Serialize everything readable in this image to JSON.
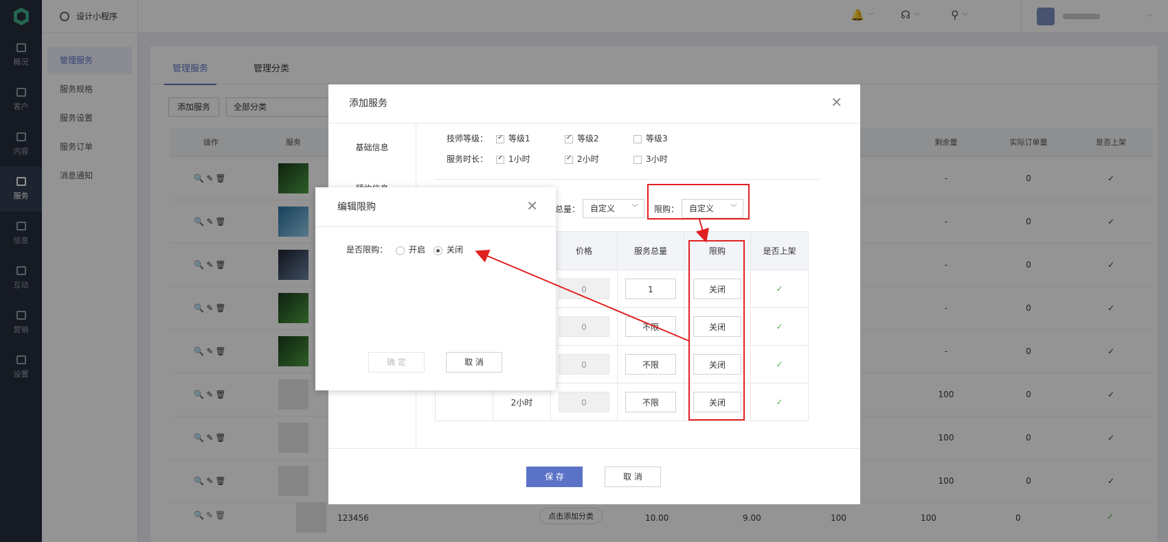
{
  "app": {
    "name": "设计小程序"
  },
  "nav": [
    {
      "label": "概况"
    },
    {
      "label": "客户"
    },
    {
      "label": "内容"
    },
    {
      "label": "服务"
    },
    {
      "label": "信息"
    },
    {
      "label": "互动"
    },
    {
      "label": "营销"
    },
    {
      "label": "设置"
    }
  ],
  "submenu": [
    {
      "label": "管理服务"
    },
    {
      "label": "服务规格"
    },
    {
      "label": "服务设置"
    },
    {
      "label": "服务订单"
    },
    {
      "label": "消息通知"
    }
  ],
  "tabs": [
    {
      "label": "管理服务"
    },
    {
      "label": "管理分类"
    }
  ],
  "toolbar": {
    "add": "添加服务",
    "category": "全部分类"
  },
  "table": {
    "headers": [
      "操作",
      "服务",
      "剩余量",
      "实际订单量",
      "是否上架"
    ],
    "rows": [
      {
        "remain": "-",
        "orders": "0"
      },
      {
        "remain": "-",
        "orders": "0"
      },
      {
        "remain": "-",
        "orders": "0"
      },
      {
        "remain": "-",
        "orders": "0"
      },
      {
        "remain": "-",
        "orders": "0"
      },
      {
        "remain": "100",
        "orders": "0"
      },
      {
        "remain": "100",
        "orders": "0"
      },
      {
        "remain": "100",
        "orders": "0"
      }
    ],
    "last": {
      "name": "123456",
      "cat": "点击添加分类",
      "price": "10.00",
      "p2": "9.00",
      "total": "100",
      "remain": "100",
      "orders": "0"
    }
  },
  "dialog": {
    "title": "添加服务",
    "side": [
      "基础信息",
      "预约信息"
    ],
    "level_label": "技师等级：",
    "levels": [
      {
        "label": "等级1",
        "checked": true
      },
      {
        "label": "等级2",
        "checked": true
      },
      {
        "label": "等级3",
        "checked": false
      }
    ],
    "dur_label": "服务时长：",
    "durs": [
      {
        "label": "1小时",
        "checked": true
      },
      {
        "label": "2小时",
        "checked": true
      },
      {
        "label": "3小时",
        "checked": false
      }
    ],
    "total_label": "总量：",
    "total_value": "自定义",
    "limit_label": "限购：",
    "limit_value": "自定义",
    "cols": [
      "价格",
      "服务总量",
      "限购",
      "是否上架"
    ],
    "rows": [
      {
        "dur": "",
        "price": "0",
        "total": "1",
        "limit": "关闭"
      },
      {
        "dur": "",
        "price": "0",
        "total": "不限",
        "limit": "关闭"
      },
      {
        "dur": "",
        "price": "0",
        "total": "不限",
        "limit": "关闭"
      },
      {
        "dur": "2小时",
        "price": "0",
        "total": "不限",
        "limit": "关闭"
      }
    ],
    "save": "保 存",
    "cancel": "取 消"
  },
  "limit_dialog": {
    "title": "编辑限购",
    "label": "是否限购：",
    "on": "开启",
    "off": "关闭",
    "confirm": "确 定",
    "cancel": "取 消"
  },
  "colors": {
    "accent": "#5b73c7",
    "annotation": "#e02020",
    "check": "#52b04a"
  }
}
